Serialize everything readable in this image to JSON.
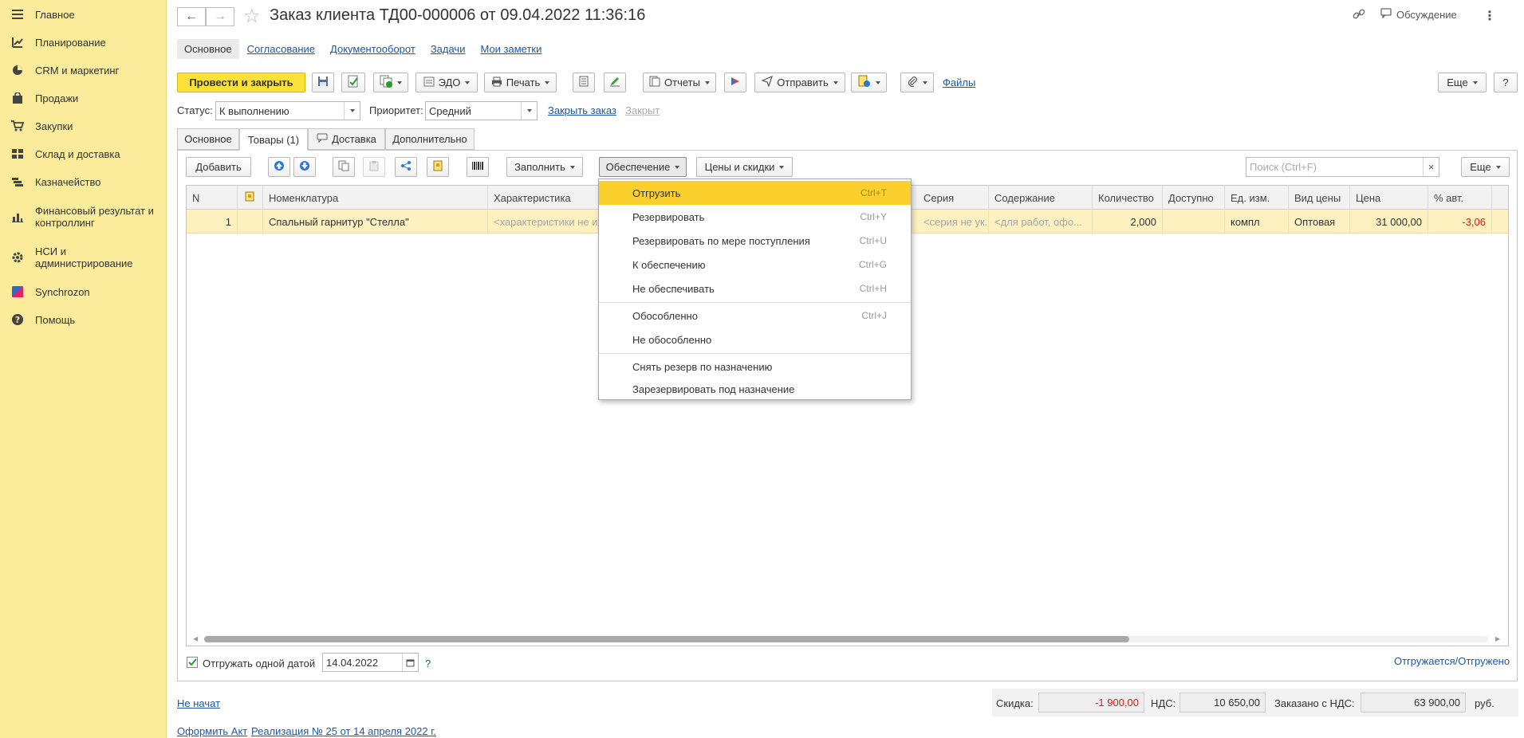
{
  "sidebar": {
    "items": [
      {
        "label": "Главное",
        "icon": "menu-icon"
      },
      {
        "label": "Планирование",
        "icon": "chart-icon"
      },
      {
        "label": "CRM и маркетинг",
        "icon": "pie-icon"
      },
      {
        "label": "Продажи",
        "icon": "bag-icon"
      },
      {
        "label": "Закупки",
        "icon": "cart-icon"
      },
      {
        "label": "Склад и доставка",
        "icon": "warehouse-icon"
      },
      {
        "label": "Казначейство",
        "icon": "treasury-icon"
      },
      {
        "label": "Финансовый результат и контроллинг",
        "icon": "bar-chart-icon"
      },
      {
        "label": "НСИ и администрирование",
        "icon": "gear-icon"
      },
      {
        "label": "Synchrozon",
        "icon": "synchrozon-icon"
      },
      {
        "label": "Помощь",
        "icon": "help-icon"
      }
    ]
  },
  "header": {
    "title": "Заказ клиента ТД00-000006 от 09.04.2022 11:36:16",
    "discussion": "Обсуждение"
  },
  "navlinks": [
    "Основное",
    "Согласование",
    "Документооборот",
    "Задачи",
    "Мои заметки"
  ],
  "toolbar": {
    "post_close": "Провести и закрыть",
    "edo": "ЭДО",
    "print": "Печать",
    "reports": "Отчеты",
    "send": "Отправить",
    "files": "Файлы",
    "more": "Еще",
    "help": "?"
  },
  "status": {
    "status_label": "Статус:",
    "status_value": "К выполнению",
    "priority_label": "Приоритет:",
    "priority_value": "Средний",
    "close_order": "Закрыть заказ",
    "closed": "Закрыт"
  },
  "tabs": [
    "Основное",
    "Товары (1)",
    "Доставка",
    "Дополнительно"
  ],
  "grid_toolbar": {
    "add": "Добавить",
    "fill": "Заполнить",
    "provision": "Обеспечение",
    "prices": "Цены и скидки",
    "search_placeholder": "Поиск (Ctrl+F)",
    "more": "Еще"
  },
  "grid": {
    "columns": [
      "N",
      "",
      "Номенклатура",
      "Характеристика",
      "Серия",
      "Содержание",
      "Количество",
      "Доступно",
      "Ед. изм.",
      "Вид цены",
      "Цена",
      "% авт."
    ],
    "row": {
      "n": "1",
      "item": "Спальный гарнитур \"Стелла\"",
      "characteristic": "<характеристики не и",
      "series": "<серия не ук...",
      "content": "<для работ, офо...",
      "quantity": "2,000",
      "available": "",
      "unit": "компл",
      "price_type": "Оптовая",
      "price": "31 000,00",
      "auto_pct": "-3,06"
    }
  },
  "menu": {
    "items": [
      {
        "label": "Отгрузить",
        "shortcut": "Ctrl+T"
      },
      {
        "label": "Резервировать",
        "shortcut": "Ctrl+Y"
      },
      {
        "label": "Резервировать по мере поступления",
        "shortcut": "Ctrl+U"
      },
      {
        "label": "К обеспечению",
        "shortcut": "Ctrl+G"
      },
      {
        "label": "Не обеспечивать",
        "shortcut": "Ctrl+H"
      },
      {
        "label": "Обособленно",
        "shortcut": "Ctrl+J"
      },
      {
        "label": "Не обособленно",
        "shortcut": ""
      },
      {
        "label": "Снять резерв по назначению",
        "shortcut": ""
      },
      {
        "label": "Зарезервировать под назначение",
        "shortcut": ""
      }
    ]
  },
  "bottom": {
    "ship_one_date": "Отгружать одной датой",
    "ship_date": "14.04.2022",
    "question": "?",
    "shipped_link": "Отгружается/Отгружено",
    "not_started": "Не начат",
    "discount_label": "Скидка:",
    "discount_value": "-1 900,00",
    "vat_label": "НДС:",
    "vat_value": "10 650,00",
    "ordered_label": "Заказано с НДС:",
    "ordered_value": "63 900,00",
    "currency": "руб.",
    "act_link": "Оформить Акт",
    "realization_link": "Реализация № 25 от 14 апреля 2022 г."
  },
  "colors": {
    "sidebar_bg": "#fbec9b",
    "primary_btn": "#fce13a",
    "menu_highlight": "#fbcf2c",
    "link": "#1b57a5",
    "negative": "#e01818"
  }
}
